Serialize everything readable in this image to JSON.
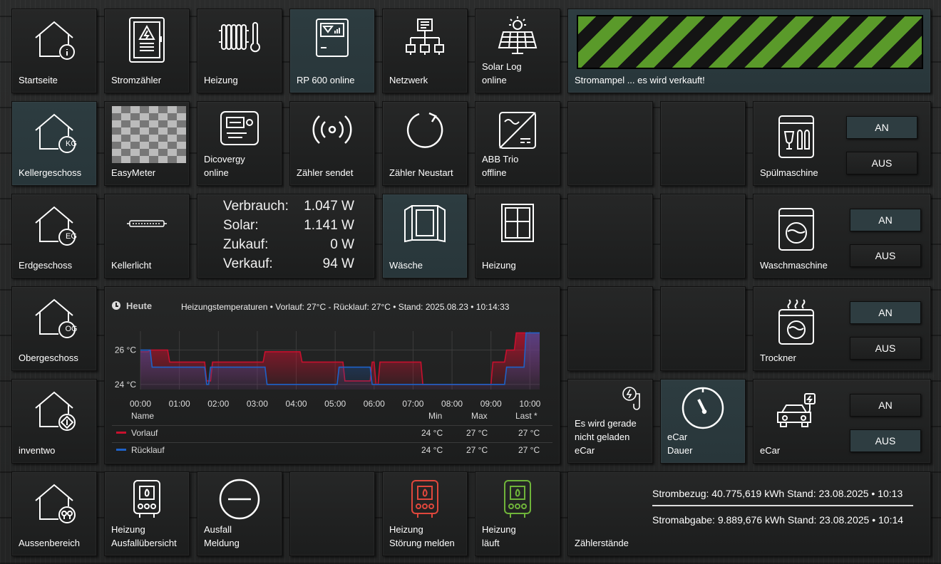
{
  "tiles": {
    "startseite": "Startseite",
    "stromzaehler": "Stromzähler",
    "heizung1": "Heizung",
    "rp600": "RP 600 online",
    "netzwerk": "Netzwerk",
    "solarlog": "Solar Log\nonline",
    "stromampel": "Stromampel ... es wird verkauft!",
    "kellergeschoss": "Kellergeschoss",
    "easymeter": "EasyMeter",
    "discovergy": "Dicovergy\nonline",
    "zaehler_sendet": "Zähler sendet",
    "zaehler_neustart": "Zähler Neustart",
    "abb_trio": "ABB Trio\noffline",
    "spuelmaschine": "Spülmaschine",
    "erdgeschoss": "Erdgeschoss",
    "kellerlicht": "Kellerlicht",
    "waesche": "Wäsche",
    "heizung2": "Heizung",
    "waschmaschine": "Waschmaschine",
    "obergeschoss": "Obergeschoss",
    "trockner": "Trockner",
    "inventwo": "inventwo",
    "ecar_status": "Es wird gerade\nnicht geladen\neCar",
    "ecar_dauer": "eCar\nDauer",
    "ecar": "eCar",
    "aussenbereich": "Aussenbereich",
    "heizung_ausfall": "Heizung\nAusfallübersicht",
    "ausfall_meldung": "Ausfall\nMeldung",
    "heizung_stoerung": "Heizung\nStörung melden",
    "heizung_laeuft": "Heizung\nläuft",
    "zaehlerstaende": "Zählerstände"
  },
  "floor_badges": {
    "kg": "KG",
    "eg": "EG",
    "og": "OG"
  },
  "buttons": {
    "an": "AN",
    "aus": "AUS"
  },
  "power": {
    "verbrauch_label": "Verbrauch:",
    "verbrauch_value": "1.047 W",
    "solar_label": "Solar:",
    "solar_value": "1.141 W",
    "zukauf_label": "Zukauf:",
    "zukauf_value": "0 W",
    "verkauf_label": "Verkauf:",
    "verkauf_value": "94 W"
  },
  "meter": {
    "bezug": "Strombezug: 40.775,619 kWh Stand: 23.08.2025 • 10:13",
    "abgabe": "Stromabgabe: 9.889,676 kWh Stand: 23.08.2025 • 10:14"
  },
  "chart_head": {
    "range": "Heute",
    "title": "Heizungstemperaturen • Vorlauf: 27°C - Rücklauf: 27°C • Stand: 2025.08.23 • 10:14:33"
  },
  "legend_table": {
    "headers": [
      "Name",
      "Min",
      "Max",
      "Last *"
    ],
    "rows": [
      {
        "name": "Vorlauf",
        "min": "24 °C",
        "max": "27 °C",
        "last": "27 °C"
      },
      {
        "name": "Rücklauf",
        "min": "24 °C",
        "max": "27 °C",
        "last": "27 °C"
      }
    ]
  },
  "colors": {
    "vorlauf": "#c8102e",
    "ruecklauf": "#1e62c8",
    "stripe_green": "#5a9a2a",
    "heizung_stoerung": "#e0473c",
    "heizung_laeuft": "#6fb43a"
  },
  "chart_data": {
    "type": "line",
    "title": "Heizungstemperaturen • Vorlauf: 27°C - Rücklauf: 27°C • Stand: 2025.08.23 • 10:14:33",
    "xlabel": "",
    "ylabel": "",
    "x_ticks": [
      "00:00",
      "01:00",
      "02:00",
      "03:00",
      "04:00",
      "05:00",
      "06:00",
      "07:00",
      "08:00",
      "09:00",
      "10:00"
    ],
    "y_ticks": [
      "24 °C",
      "26 °C"
    ],
    "ylim": [
      23.7,
      27.1
    ],
    "xlim": [
      0,
      10.25
    ],
    "grid": true,
    "series": [
      {
        "name": "Vorlauf",
        "color": "#c8102e",
        "x": [
          0,
          0.2,
          0.25,
          0.7,
          0.75,
          1.65,
          1.7,
          1.8,
          1.85,
          3.15,
          3.2,
          4.1,
          4.15,
          5.2,
          5.25,
          5.9,
          5.95,
          6.0,
          6.05,
          6.1,
          6.15,
          7.2,
          7.25,
          9.0,
          9.05,
          9.35,
          9.4,
          9.6,
          9.65,
          9.85,
          9.9,
          10.25
        ],
        "y": [
          25.9,
          25.9,
          26.0,
          26.0,
          25.3,
          25.3,
          24.2,
          24.2,
          25.3,
          25.3,
          25.9,
          25.9,
          25.3,
          25.3,
          24.2,
          24.2,
          25.3,
          25.3,
          24.0,
          24.0,
          25.3,
          25.3,
          24.0,
          24.0,
          25.3,
          25.3,
          26.0,
          26.0,
          27.0,
          27.0,
          27.0,
          27.0
        ]
      },
      {
        "name": "Rücklauf",
        "color": "#1e62c8",
        "x": [
          0,
          0.25,
          0.3,
          1.65,
          1.7,
          1.75,
          1.8,
          3.2,
          3.25,
          5.05,
          5.1,
          5.9,
          5.95,
          9.35,
          9.4,
          9.85,
          9.9,
          10.25
        ],
        "y": [
          26.0,
          26.0,
          25.0,
          25.0,
          24.0,
          24.0,
          25.0,
          25.0,
          24.0,
          24.0,
          25.0,
          25.0,
          24.0,
          24.0,
          25.0,
          25.0,
          27.0,
          27.0
        ]
      }
    ]
  }
}
